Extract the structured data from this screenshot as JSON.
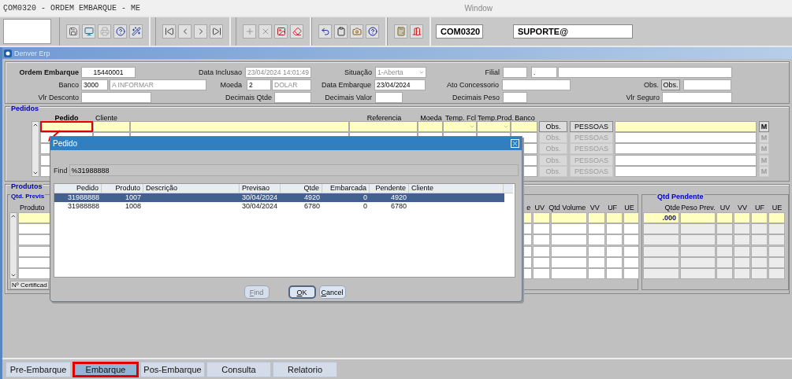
{
  "window": {
    "title": "ÇOM0320 - ORDEM EMBARQUE - ME",
    "menu": "Window"
  },
  "toolbar": {
    "program": "COM0320",
    "user": "SUPORTE@"
  },
  "inner_window": {
    "title": "Denver Erp"
  },
  "header": {
    "lines": [
      {
        "entries": [
          {
            "label": "Ordem Embarque",
            "fields": [
              {
                "kind": "text",
                "value": "15440001",
                "disabled": false
              }
            ]
          },
          {
            "label": "Data Inclusao",
            "fields": [
              {
                "kind": "text",
                "value": "23/04/2024 14:01:49",
                "disabled": true
              }
            ]
          },
          {
            "label": "Situação",
            "fields": [
              {
                "kind": "select",
                "value": "1-Aberta",
                "disabled": true
              }
            ]
          },
          {
            "label": "Filial",
            "fields": [
              {
                "kind": "text"
              },
              {
                "kind": "text",
                "value": "."
              },
              {
                "kind": "text"
              }
            ]
          }
        ]
      },
      {
        "entries": [
          {
            "label": "Banco",
            "fields": [
              {
                "kind": "text",
                "value": "3000",
                "disabled": false
              },
              {
                "kind": "text",
                "value": "A INFORMAR",
                "disabled": true
              }
            ]
          },
          {
            "label": "Moeda",
            "fields": [
              {
                "kind": "text",
                "value": "2",
                "disabled": false
              },
              {
                "kind": "text",
                "value": "DOLAR",
                "disabled": true
              }
            ]
          },
          {
            "label": "Data Embarque",
            "fields": [
              {
                "kind": "text",
                "value": "23/04/2024",
                "disabled": false
              }
            ]
          },
          {
            "label": "Ato Concessorio",
            "fields": [
              {
                "kind": "text"
              }
            ]
          },
          {
            "label": "Obs.",
            "fields": [
              {
                "kind": "button",
                "value": "Obs."
              },
              {
                "kind": "text"
              }
            ]
          }
        ]
      },
      {
        "entries": [
          {
            "label": "Vlr Desconto",
            "fields": [
              {
                "kind": "text"
              }
            ]
          },
          {
            "label": "Decimais Qtde",
            "fields": [
              {
                "kind": "text"
              }
            ]
          },
          {
            "label": "Decimais Valor",
            "fields": [
              {
                "kind": "text"
              }
            ]
          },
          {
            "label": "Decimais Peso",
            "fields": [
              {
                "kind": "text"
              }
            ]
          },
          {
            "label": "Vlr Seguro",
            "fields": [
              {
                "kind": "text"
              }
            ]
          }
        ]
      }
    ]
  },
  "pedidos": {
    "title": "Pedidos",
    "columns": [
      "Pedido",
      "Cliente",
      "Referencia",
      "Moeda",
      "Temp. Fcl",
      "Temp.Prod.",
      "Banco"
    ],
    "rows": [
      {
        "current": true,
        "highlighted": true,
        "obs": "Obs.",
        "pessoas": "PESSOAS",
        "m": "M",
        "disabled": false
      },
      {
        "current": false,
        "highlighted": false,
        "obs": "Obs.",
        "pessoas": "PESSOAS",
        "m": "M",
        "disabled": true
      },
      {
        "current": false,
        "highlighted": false,
        "obs": "Obs.",
        "pessoas": "PESSOAS",
        "m": "M",
        "disabled": true
      },
      {
        "current": false,
        "highlighted": false,
        "obs": "Obs.",
        "pessoas": "PESSOAS",
        "m": "M",
        "disabled": true
      },
      {
        "current": false,
        "highlighted": false,
        "obs": "Obs.",
        "pessoas": "PESSOAS",
        "m": "M",
        "disabled": true
      }
    ]
  },
  "produtos": {
    "title": "Produtos",
    "left_group": "Qtd. Previs",
    "left_columns": [
      "Produto",
      "e",
      "UV",
      "Qtd Volume",
      "VV",
      "UF",
      "UE"
    ],
    "right_group": "Qtd Pendente",
    "right_columns": [
      "Qtde",
      "Peso Prev.",
      "UV",
      "VV",
      "UF",
      "UE"
    ],
    "rows": [
      {
        "current": true,
        "qtde": ".000"
      },
      {
        "current": false
      },
      {
        "current": false
      },
      {
        "current": false
      },
      {
        "current": false
      },
      {
        "current": false
      }
    ],
    "certificado_label": "Nº Certificad"
  },
  "dialog": {
    "title": "Pedido",
    "find_label": "Find",
    "find_value": "%31988888",
    "columns": [
      "Pedido",
      "Produto",
      "Descrição",
      "Previsao",
      "Qtde",
      "Embarcada",
      "Pendente",
      "Cliente"
    ],
    "rows": [
      {
        "selected": true,
        "cells": [
          "31988888",
          "1007",
          "",
          "30/04/2024",
          "4920",
          "0",
          "4920",
          ""
        ]
      },
      {
        "selected": false,
        "cells": [
          "31988888",
          "1008",
          "",
          "30/04/2024",
          "6780",
          "0",
          "6780",
          ""
        ]
      }
    ],
    "buttons": [
      {
        "label": "Find",
        "disabled": true,
        "default": false
      },
      {
        "label": "OK",
        "disabled": false,
        "default": true
      },
      {
        "label": "Cancel",
        "disabled": false,
        "default": false
      }
    ]
  },
  "tabs": [
    {
      "label": "Pre-Embarque",
      "selected": false
    },
    {
      "label": "Embarque",
      "selected": true
    },
    {
      "label": "Pos-Embarque",
      "selected": false
    },
    {
      "label": "Consulta",
      "selected": false
    },
    {
      "label": "Relatorio",
      "selected": false
    }
  ]
}
